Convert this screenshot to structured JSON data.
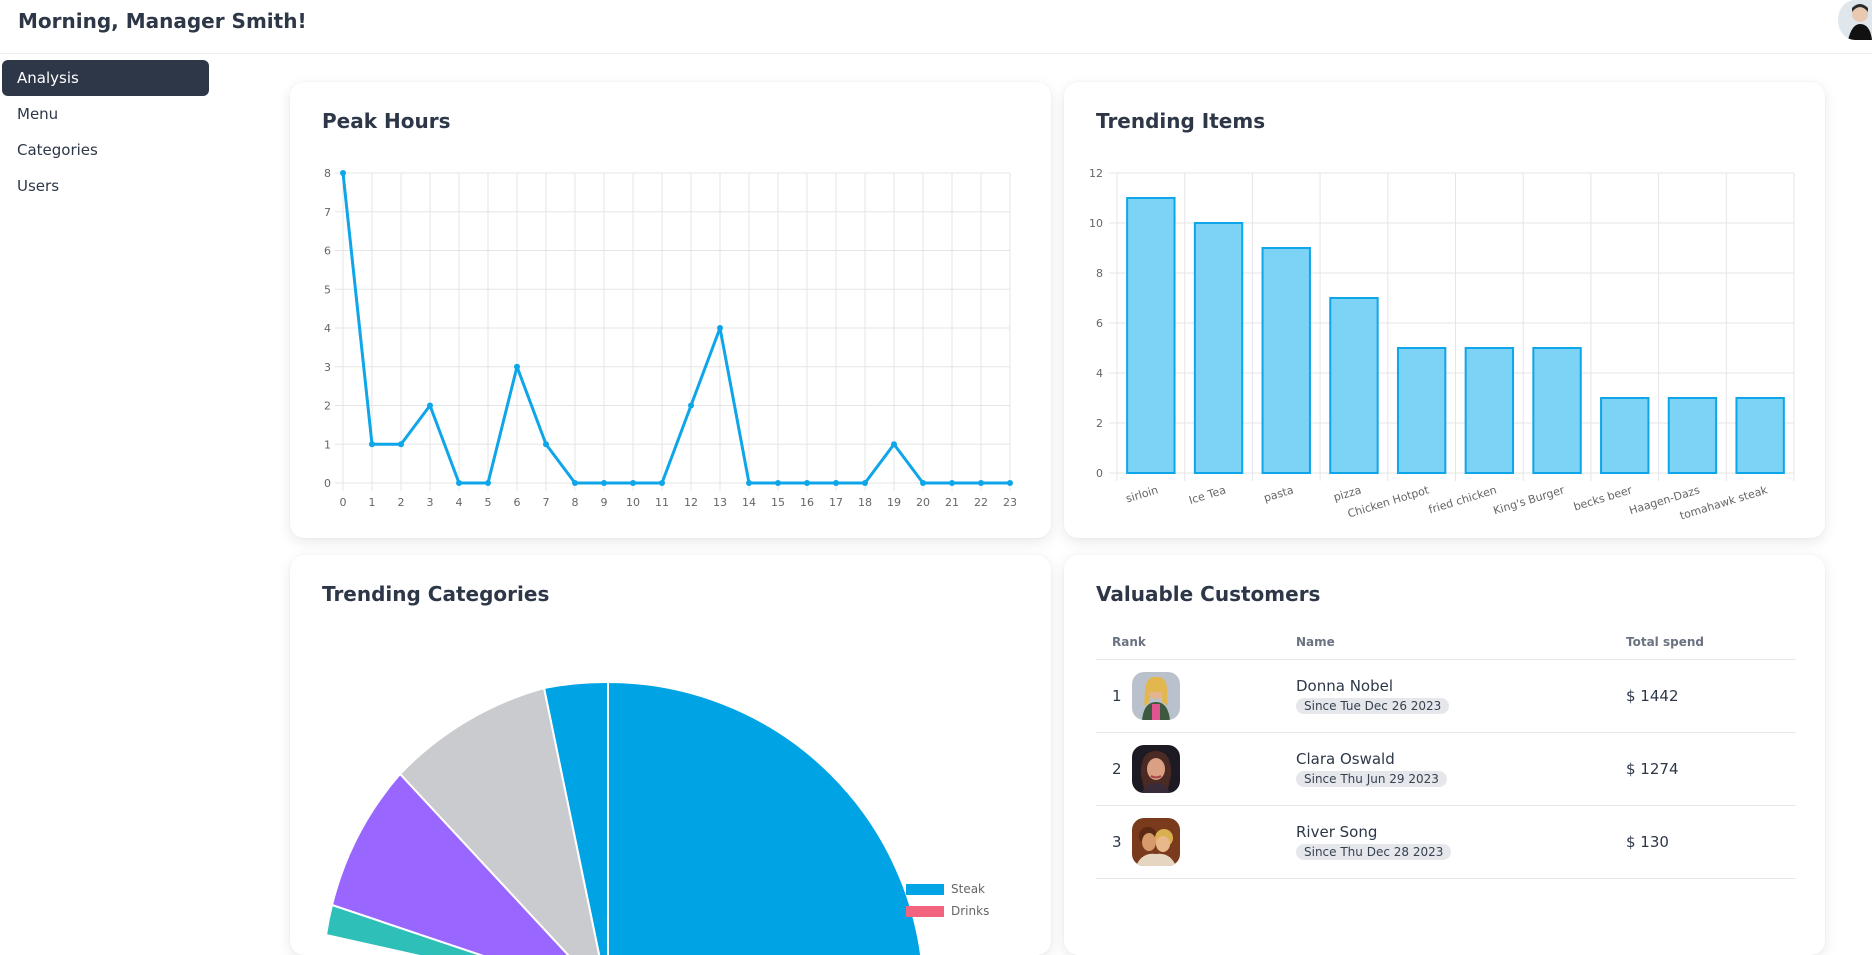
{
  "header": {
    "greeting": "Morning, Manager Smith!"
  },
  "sidebar": {
    "items": [
      {
        "label": "Analysis",
        "active": true
      },
      {
        "label": "Menu",
        "active": false
      },
      {
        "label": "Categories",
        "active": false
      },
      {
        "label": "Users",
        "active": false
      }
    ]
  },
  "colors": {
    "accent": "#0ea5e9",
    "barFill": "#7dd3f5",
    "sidebarActive": "#2d3748",
    "pieSteak": "#00a3e4",
    "pieDrinks": "#f2637d"
  },
  "cards": {
    "peak_title": "Peak Hours",
    "trend_title": "Trending Items",
    "cats_title": "Trending Categories",
    "cust_title": "Valuable Customers"
  },
  "chart_data": [
    {
      "type": "line",
      "title": "Peak Hours",
      "x": [
        0,
        1,
        2,
        3,
        4,
        5,
        6,
        7,
        8,
        9,
        10,
        11,
        12,
        13,
        14,
        15,
        16,
        17,
        18,
        19,
        20,
        21,
        22,
        23
      ],
      "values": [
        8,
        1,
        1,
        2,
        0,
        0,
        3,
        1,
        0,
        0,
        0,
        0,
        2,
        4,
        0,
        0,
        0,
        0,
        0,
        1,
        0,
        0,
        0,
        0
      ],
      "ylim": [
        0,
        8
      ],
      "grid": true
    },
    {
      "type": "bar",
      "title": "Trending Items",
      "categories": [
        "sirloin",
        "Ice Tea",
        "pasta",
        "pizza",
        "Chicken Hotpot",
        "fried chicken",
        "King's Burger",
        "becks beer",
        "Haagen-Dazs",
        "tomahawk steak"
      ],
      "values": [
        11,
        10,
        9,
        7,
        5,
        5,
        5,
        3,
        3,
        3
      ],
      "ylim": [
        0,
        12
      ],
      "grid": true
    },
    {
      "type": "pie",
      "title": "Trending Categories",
      "legend": [
        "Steak",
        "Drinks"
      ],
      "legend_placement": "right"
    }
  ],
  "customers": {
    "headers": {
      "rank": "Rank",
      "name": "Name",
      "total": "Total spend"
    },
    "rows": [
      {
        "rank": "1",
        "name": "Donna Nobel",
        "since": "Since Tue Dec 26 2023",
        "total": "$ 1442"
      },
      {
        "rank": "2",
        "name": "Clara Oswald",
        "since": "Since Thu Jun 29 2023",
        "total": "$ 1274"
      },
      {
        "rank": "3",
        "name": "River Song",
        "since": "Since Thu Dec 28 2023",
        "total": "$ 130"
      }
    ]
  }
}
